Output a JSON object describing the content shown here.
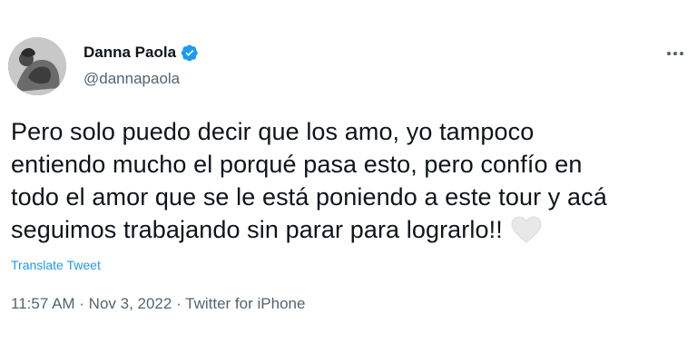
{
  "author": {
    "name": "Danna Paola",
    "handle": "@dannapaola",
    "verified": true,
    "avatar_icon": "profile-photo"
  },
  "tweet": {
    "lines": [
      "Pero solo puedo decir que los amo, yo tampoco",
      "entiendo mucho el porqué pasa esto, pero confío en",
      "todo el amor que se le está poniendo a este tour y acá",
      "seguimos trabajando sin parar para lograrlo!!"
    ],
    "emoji": "white-heart-icon",
    "translate_label": "Translate Tweet"
  },
  "meta": {
    "text": "11:57 AM · Nov 3, 2022 · Twitter for iPhone"
  },
  "colors": {
    "accent": "#1d9bf0",
    "secondary_text": "#536471",
    "primary_text": "#0f1419"
  }
}
